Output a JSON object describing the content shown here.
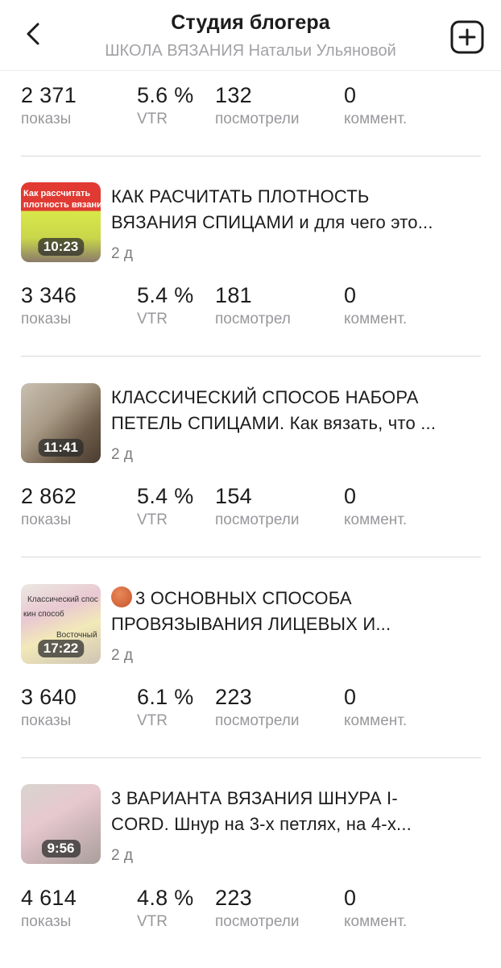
{
  "header": {
    "title": "Студия блогера",
    "subtitle": "ШКОЛА ВЯЗАНИЯ Натальи Ульяновой"
  },
  "top_stats": {
    "views": "2 371",
    "views_label": "показы",
    "vtr": "5.6 %",
    "vtr_label": "VTR",
    "watched": "132",
    "watched_label": "посмотрели",
    "comments": "0",
    "comments_label": "коммент."
  },
  "videos": [
    {
      "title_line1": "КАК РАСЧИТАТЬ ПЛОТНОСТЬ",
      "title_line2": "ВЯЗАНИЯ СПИЦАМИ и для чего это...",
      "age": "2 д",
      "duration": "10:23",
      "thumb_text1": "Как рассчитать",
      "thumb_text2": "плотность вязания",
      "stats": {
        "views": "3 346",
        "views_label": "показы",
        "vtr": "5.4 %",
        "vtr_label": "VTR",
        "watched": "181",
        "watched_label": "посмотрел",
        "comments": "0",
        "comments_label": "коммент."
      }
    },
    {
      "title_line1": "КЛАССИЧЕСКИЙ СПОСОБ НАБОРА",
      "title_line2": "ПЕТЕЛЬ СПИЦАМИ. Как вязать, что ...",
      "age": "2 д",
      "duration": "11:41",
      "stats": {
        "views": "2 862",
        "views_label": "показы",
        "vtr": "5.4 %",
        "vtr_label": "VTR",
        "watched": "154",
        "watched_label": "посмотрели",
        "comments": "0",
        "comments_label": "коммент."
      }
    },
    {
      "title_line1": "3 ОСНОВНЫХ СПОСОБА",
      "title_line2": "ПРОВЯЗЫВАНИЯ ЛИЦЕВЫХ И...",
      "age": "2 д",
      "duration": "17:22",
      "thumb_text1": "Классический спос",
      "thumb_text2": "кин способ",
      "thumb_text3": "Восточный",
      "stats": {
        "views": "3 640",
        "views_label": "показы",
        "vtr": "6.1 %",
        "vtr_label": "VTR",
        "watched": "223",
        "watched_label": "посмотрели",
        "comments": "0",
        "comments_label": "коммент."
      }
    },
    {
      "title_line1": "3 ВАРИАНТА ВЯЗАНИЯ ШНУРА I-",
      "title_line2": "CORD. Шнур на 3-х петлях, на 4-х...",
      "age": "2 д",
      "duration": "9:56",
      "stats": {
        "views": "4 614",
        "views_label": "показы",
        "vtr": "4.8 %",
        "vtr_label": "VTR",
        "watched": "223",
        "watched_label": "посмотрели",
        "comments": "0",
        "comments_label": "коммент."
      }
    }
  ],
  "icons": {
    "back": "chevron-left-icon",
    "add": "plus-square-icon",
    "yarn": "yarn-ball-emoji"
  },
  "colors": {
    "text": "#1c1c1e",
    "secondary": "#98989d",
    "divider": "#d8d8dc"
  }
}
